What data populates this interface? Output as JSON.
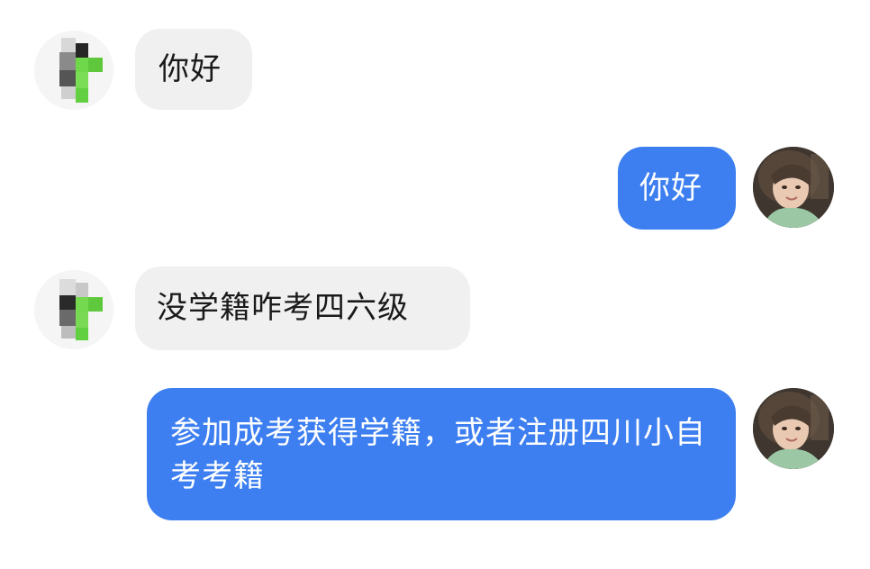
{
  "chat": {
    "messages": [
      {
        "sender": "contact",
        "text": "你好"
      },
      {
        "sender": "me",
        "text": "你好"
      },
      {
        "sender": "contact",
        "text": "没学籍咋考四六级"
      },
      {
        "sender": "me",
        "text": "参加成考获得学籍，或者注册四川小自考考籍"
      }
    ]
  },
  "avatars": {
    "contact": "pixelated-avatar",
    "me": "user-photo-avatar"
  },
  "colors": {
    "incoming_bubble": "#f0f0f0",
    "outgoing_bubble": "#3d7ff0",
    "accent_green": "#6cd44a"
  }
}
